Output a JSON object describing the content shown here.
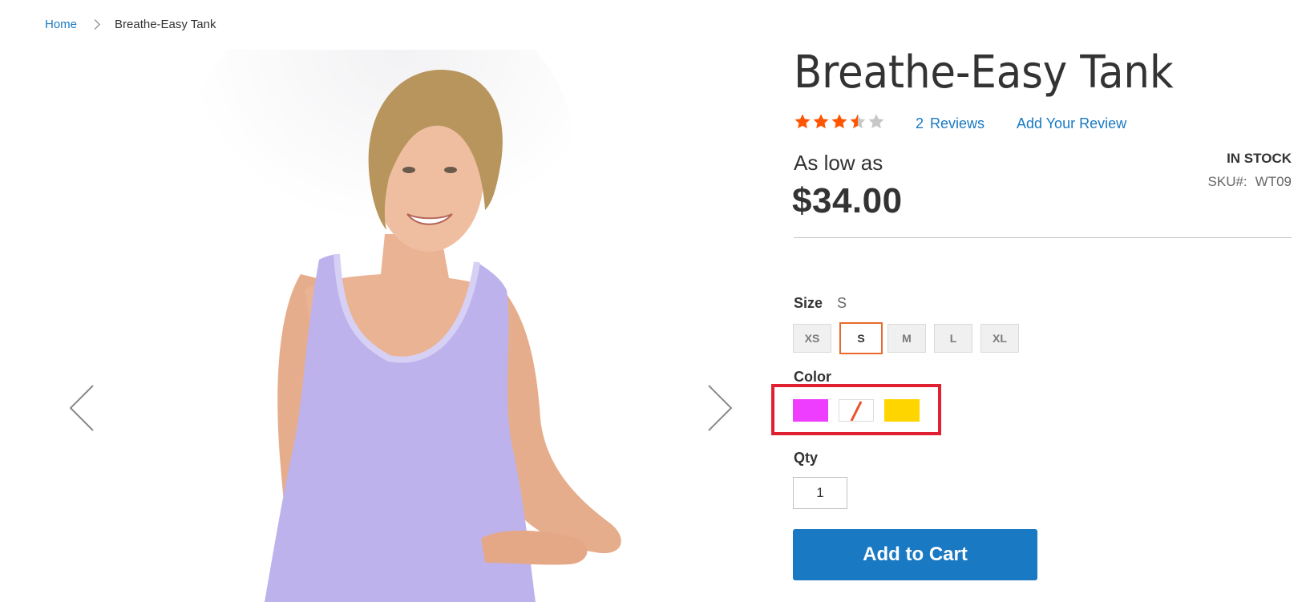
{
  "breadcrumb": {
    "home": "Home",
    "current": "Breathe-Easy Tank"
  },
  "product": {
    "title": "Breathe-Easy Tank",
    "rating_stars": 3.5,
    "rating_max": 5,
    "reviews_count": "2",
    "reviews_label": "Reviews",
    "add_review_label": "Add Your Review",
    "price_prefix": "As low as",
    "price": "$34.00",
    "stock_status": "IN STOCK",
    "sku_label": "SKU#:",
    "sku_value": "WT09"
  },
  "options": {
    "size_label": "Size",
    "size_selected": "S",
    "sizes": [
      "XS",
      "S",
      "M",
      "L",
      "XL"
    ],
    "color_label": "Color",
    "colors": [
      "#ef3dff",
      "#ffffff",
      "#ffd500"
    ],
    "qty_label": "Qty",
    "qty_value": "1",
    "add_to_cart_label": "Add to Cart"
  },
  "colors": {
    "link": "#1979c3",
    "star": "#ff5501",
    "star_empty": "#c7c7c7",
    "button": "#1979c3",
    "highlight": "#e02030",
    "selected_border": "#e86b2d"
  }
}
